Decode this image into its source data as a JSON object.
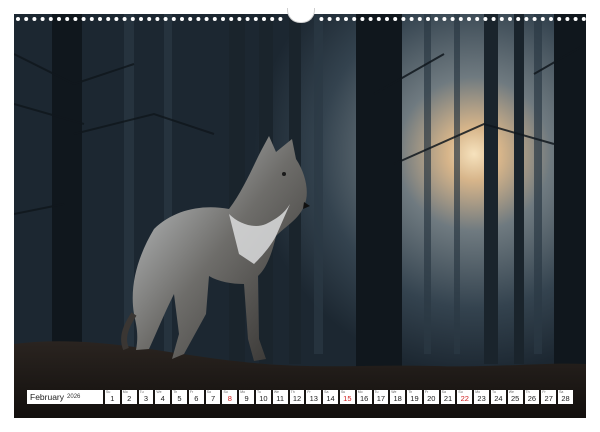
{
  "calendar": {
    "month": "February",
    "year": "2026",
    "days": [
      {
        "n": "1",
        "wd": "Su",
        "holiday": false
      },
      {
        "n": "2",
        "wd": "Mo",
        "holiday": false
      },
      {
        "n": "3",
        "wd": "Tu",
        "holiday": false
      },
      {
        "n": "4",
        "wd": "We",
        "holiday": false
      },
      {
        "n": "5",
        "wd": "Th",
        "holiday": false
      },
      {
        "n": "6",
        "wd": "Fr",
        "holiday": false
      },
      {
        "n": "7",
        "wd": "Sa",
        "holiday": false
      },
      {
        "n": "8",
        "wd": "Su",
        "holiday": true
      },
      {
        "n": "9",
        "wd": "Mo",
        "holiday": false
      },
      {
        "n": "10",
        "wd": "Tu",
        "holiday": false
      },
      {
        "n": "11",
        "wd": "We",
        "holiday": false
      },
      {
        "n": "12",
        "wd": "Th",
        "holiday": false
      },
      {
        "n": "13",
        "wd": "Fr",
        "holiday": false
      },
      {
        "n": "14",
        "wd": "Sa",
        "holiday": false
      },
      {
        "n": "15",
        "wd": "Su",
        "holiday": true
      },
      {
        "n": "16",
        "wd": "Mo",
        "holiday": false
      },
      {
        "n": "17",
        "wd": "Tu",
        "holiday": false
      },
      {
        "n": "18",
        "wd": "We",
        "holiday": false
      },
      {
        "n": "19",
        "wd": "Th",
        "holiday": false
      },
      {
        "n": "20",
        "wd": "Fr",
        "holiday": false
      },
      {
        "n": "21",
        "wd": "Sa",
        "holiday": false
      },
      {
        "n": "22",
        "wd": "Su",
        "holiday": true
      },
      {
        "n": "23",
        "wd": "Mo",
        "holiday": false
      },
      {
        "n": "24",
        "wd": "Tu",
        "holiday": false
      },
      {
        "n": "25",
        "wd": "We",
        "holiday": false
      },
      {
        "n": "26",
        "wd": "Th",
        "holiday": false
      },
      {
        "n": "27",
        "wd": "Fr",
        "holiday": false
      },
      {
        "n": "28",
        "wd": "Sa",
        "holiday": false
      }
    ]
  },
  "colors": {
    "holiday": "#d02020",
    "forest": "#1b2630",
    "sunlight": "#f3d9b0"
  },
  "photo": {
    "subject": "wolf-in-forest"
  }
}
